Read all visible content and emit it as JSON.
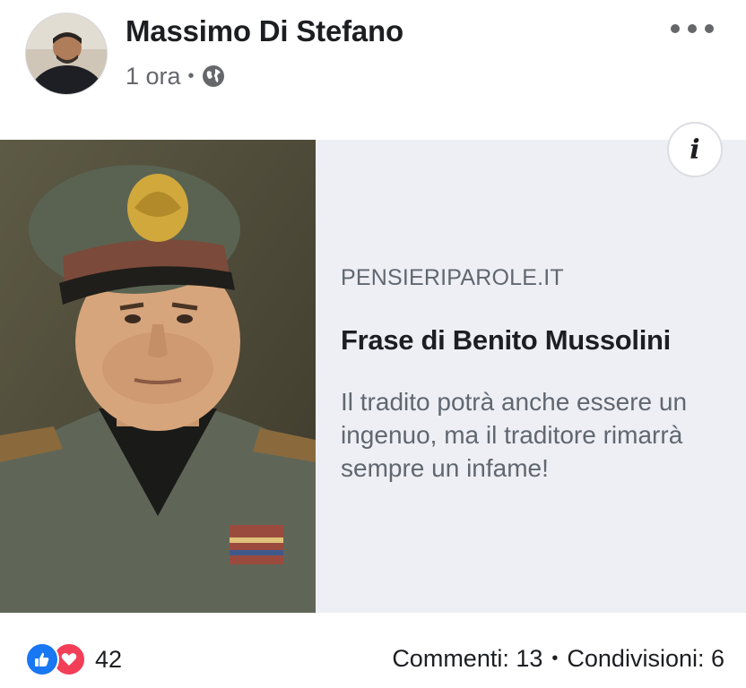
{
  "post": {
    "author": "Massimo Di Stefano",
    "time": "1 ora",
    "separator": "•",
    "privacy_icon": "globe-icon",
    "more_icon": "more-options-icon"
  },
  "link_card": {
    "domain": "PENSIERIPAROLE.IT",
    "title": "Frase di Benito Mussolini",
    "description": "Il tradito potrà anche essere un ingenuo, ma il traditore rimarrà sempre un infame!",
    "info_icon": "i",
    "background_color": "#eeeff4"
  },
  "footer": {
    "reaction_count": "42",
    "comments": "Commenti: 13",
    "separator": "•",
    "shares": "Condivisioni: 6",
    "like_color": "#1877f2",
    "love_color": "#f33e58"
  }
}
